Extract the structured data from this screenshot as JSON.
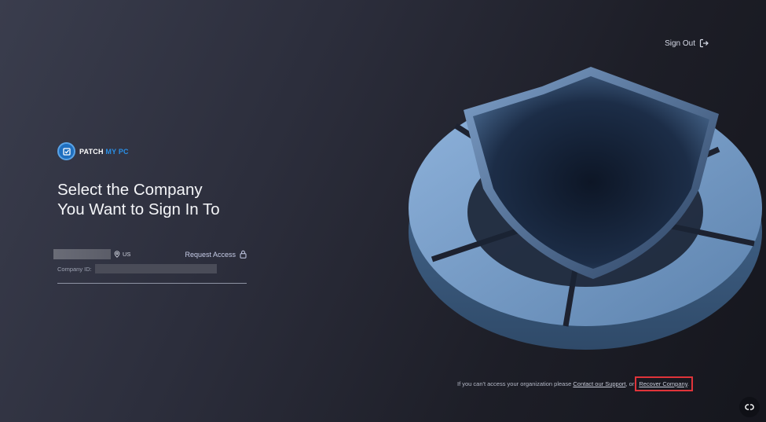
{
  "header": {
    "signout_label": "Sign Out"
  },
  "logo": {
    "word1": "PATCH",
    "word2": "MY PC"
  },
  "title": {
    "line1": "Select the Company",
    "line2": "You Want to Sign In To"
  },
  "company": {
    "region": "US",
    "request_access_label": "Request Access",
    "id_label": "Company ID:"
  },
  "footer": {
    "prefix": "If you can't access your organization please",
    "support_link": "Contact our Support",
    "middle": ", or",
    "recover_link": "Recover Company",
    "suffix": "."
  },
  "colors": {
    "accent_blue": "#2a8fe6",
    "highlight_red": "#e0343a"
  },
  "icons": {
    "signout": "sign-out-icon",
    "location": "location-pin-icon",
    "lock": "lock-icon",
    "chat": "chat-icon"
  }
}
